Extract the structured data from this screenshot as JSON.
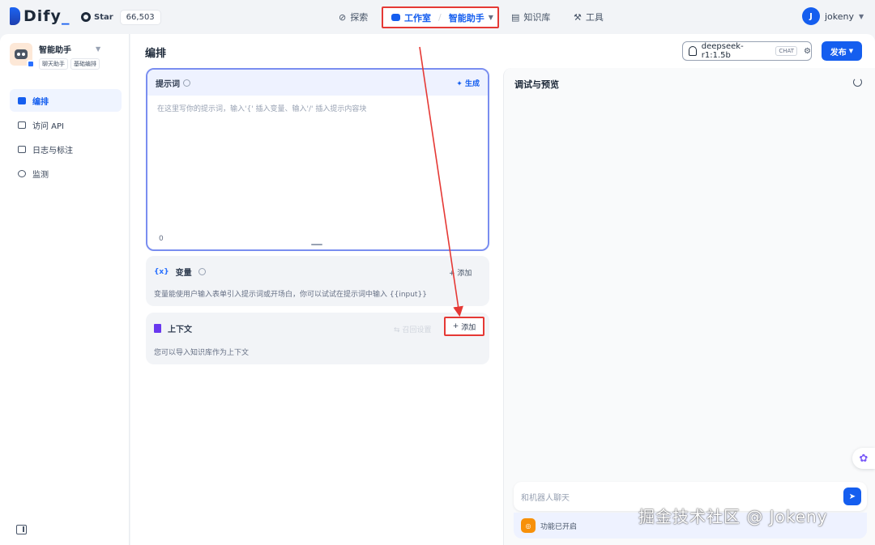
{
  "header": {
    "logo_text": "Dify",
    "github_star_label": "Star",
    "github_star_count": "66,503",
    "nav": {
      "explore": "探索",
      "studio": "工作室",
      "current_app": "智能助手",
      "knowledge": "知识库",
      "tools": "工具"
    },
    "user": {
      "initial": "J",
      "name": "jokeny"
    }
  },
  "sidebar": {
    "app": {
      "name": "智能助手",
      "tags": [
        "聊天助手",
        "基础编排"
      ]
    },
    "items": [
      {
        "label": "编排",
        "active": true
      },
      {
        "label": "访问 API",
        "active": false
      },
      {
        "label": "日志与标注",
        "active": false
      },
      {
        "label": "监测",
        "active": false
      }
    ]
  },
  "main": {
    "title": "编排",
    "model": {
      "name": "deepseek-r1:1.5b",
      "mode_badge": "CHAT"
    },
    "publish_label": "发布",
    "prompt": {
      "title": "提示词",
      "generate_label": "生成",
      "placeholder": "在这里写你的提示词，输入'{' 插入变量、输入'/' 插入提示内容块",
      "char_count": "0"
    },
    "variables": {
      "title": "变量",
      "add_label": "添加",
      "description": "变量能使用户输入表单引入提示词或开场白，你可以试试在提示词中输入 {{input}}"
    },
    "context": {
      "title": "上下文",
      "recall_label": "召回设置",
      "add_label": "添加",
      "description": "您可以导入知识库作为上下文"
    }
  },
  "debug": {
    "title": "调试与预览",
    "chat_placeholder": "和机器人聊天",
    "feature_status": "功能已开启"
  },
  "watermark": "掘金技术社区 @ Jokeny",
  "colors": {
    "accent": "#155eef",
    "annotation_red": "#e53935"
  }
}
